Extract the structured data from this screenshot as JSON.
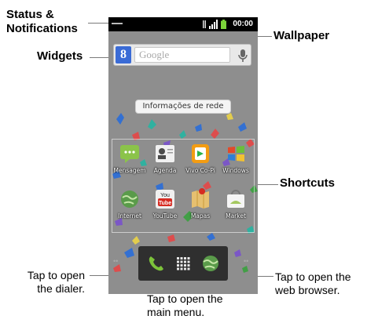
{
  "callouts": {
    "status_notifications": [
      "Status &",
      "Notifications"
    ],
    "widgets": "Widgets",
    "wallpaper": "Wallpaper",
    "shortcuts": "Shortcuts",
    "dialer": [
      "Tap to open",
      "the dialer."
    ],
    "main_menu": [
      "Tap to open the",
      "main menu."
    ],
    "browser": [
      "Tap to open the",
      "web browser."
    ]
  },
  "phone": {
    "status_time": "00:00",
    "search_placeholder": "Google",
    "search_button_letter": "8",
    "network_widget": "Informações de rede",
    "apps": [
      {
        "label": "Mensagem",
        "icon": "message-icon",
        "color": "#8bc34a"
      },
      {
        "label": "Agenda",
        "icon": "contacts-icon",
        "color": "#f0f0f0"
      },
      {
        "label": "Vivo Co-Pi",
        "icon": "vivo-icon",
        "color": "#f39c12"
      },
      {
        "label": "Windows",
        "icon": "windows-icon",
        "color": "#3c8dbc"
      },
      {
        "label": "Internet",
        "icon": "globe-icon",
        "color": "#5a9b4a"
      },
      {
        "label": "YouTube",
        "icon": "youtube-icon",
        "color": "#d62b22"
      },
      {
        "label": "Mapas",
        "icon": "maps-icon",
        "color": "#e6c070"
      },
      {
        "label": "Market",
        "icon": "market-icon",
        "color": "#a5c860"
      }
    ],
    "dock": [
      "phone-icon",
      "apps-grid-icon",
      "browser-globe-icon"
    ]
  }
}
